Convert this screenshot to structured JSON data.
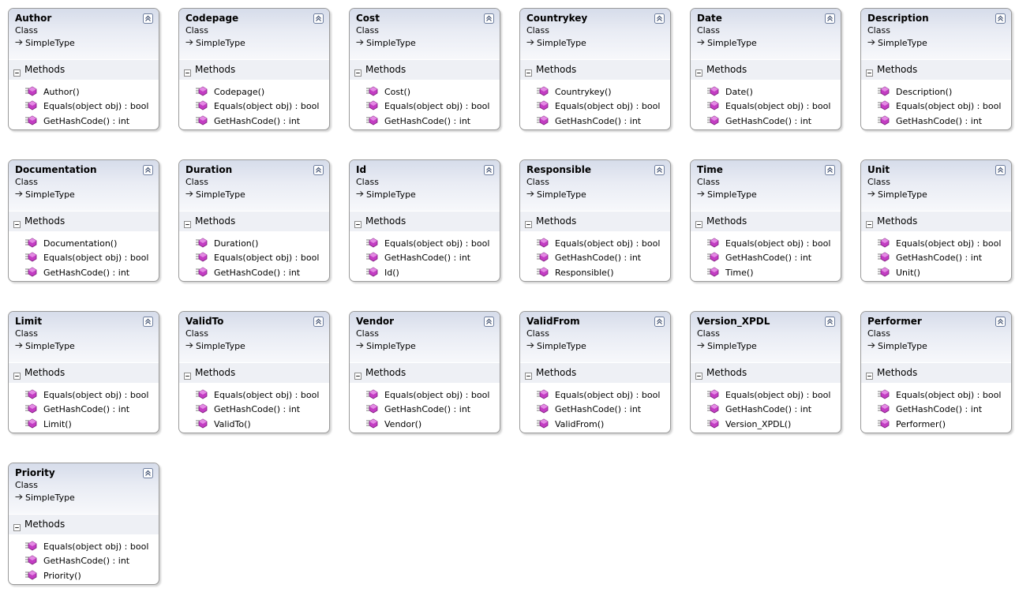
{
  "section_label": "Methods",
  "colors": {
    "border": "#9a9a9a",
    "header_top": "#d6dcea",
    "header_bottom": "#f7f8fb",
    "method_icon": "#c33dc3"
  },
  "icons": {
    "collapse": "double-chevron-up-icon",
    "inheritance": "inheritance-arrow-icon",
    "section_toggle": "minus-square-icon",
    "method": "public-method-icon"
  },
  "classes": [
    {
      "name": "Author",
      "kind": "Class",
      "base": "SimpleType",
      "methods": [
        "Author()",
        "Equals(object obj) : bool",
        "GetHashCode() : int"
      ]
    },
    {
      "name": "Codepage",
      "kind": "Class",
      "base": "SimpleType",
      "methods": [
        "Codepage()",
        "Equals(object obj) : bool",
        "GetHashCode() : int"
      ]
    },
    {
      "name": "Cost",
      "kind": "Class",
      "base": "SimpleType",
      "methods": [
        "Cost()",
        "Equals(object obj) : bool",
        "GetHashCode() : int"
      ]
    },
    {
      "name": "Countrykey",
      "kind": "Class",
      "base": "SimpleType",
      "methods": [
        "Countrykey()",
        "Equals(object obj) : bool",
        "GetHashCode() : int"
      ]
    },
    {
      "name": "Date",
      "kind": "Class",
      "base": "SimpleType",
      "methods": [
        "Date()",
        "Equals(object obj) : bool",
        "GetHashCode() : int"
      ]
    },
    {
      "name": "Description",
      "kind": "Class",
      "base": "SimpleType",
      "methods": [
        "Description()",
        "Equals(object obj) : bool",
        "GetHashCode() : int"
      ]
    },
    {
      "name": "Documentation",
      "kind": "Class",
      "base": "SimpleType",
      "methods": [
        "Documentation()",
        "Equals(object obj) : bool",
        "GetHashCode() : int"
      ]
    },
    {
      "name": "Duration",
      "kind": "Class",
      "base": "SimpleType",
      "methods": [
        "Duration()",
        "Equals(object obj) : bool",
        "GetHashCode() : int"
      ]
    },
    {
      "name": "Id",
      "kind": "Class",
      "base": "SimpleType",
      "methods": [
        "Equals(object obj) : bool",
        "GetHashCode() : int",
        "Id()"
      ]
    },
    {
      "name": "Responsible",
      "kind": "Class",
      "base": "SimpleType",
      "methods": [
        "Equals(object obj) : bool",
        "GetHashCode() : int",
        "Responsible()"
      ]
    },
    {
      "name": "Time",
      "kind": "Class",
      "base": "SimpleType",
      "methods": [
        "Equals(object obj) : bool",
        "GetHashCode() : int",
        "Time()"
      ]
    },
    {
      "name": "Unit",
      "kind": "Class",
      "base": "SimpleType",
      "methods": [
        "Equals(object obj) : bool",
        "GetHashCode() : int",
        "Unit()"
      ]
    },
    {
      "name": "Limit",
      "kind": "Class",
      "base": "SimpleType",
      "methods": [
        "Equals(object obj) : bool",
        "GetHashCode() : int",
        "Limit()"
      ]
    },
    {
      "name": "ValidTo",
      "kind": "Class",
      "base": "SimpleType",
      "methods": [
        "Equals(object obj) : bool",
        "GetHashCode() : int",
        "ValidTo()"
      ]
    },
    {
      "name": "Vendor",
      "kind": "Class",
      "base": "SimpleType",
      "methods": [
        "Equals(object obj) : bool",
        "GetHashCode() : int",
        "Vendor()"
      ]
    },
    {
      "name": "ValidFrom",
      "kind": "Class",
      "base": "SimpleType",
      "methods": [
        "Equals(object obj) : bool",
        "GetHashCode() : int",
        "ValidFrom()"
      ]
    },
    {
      "name": "Version_XPDL",
      "kind": "Class",
      "base": "SimpleType",
      "methods": [
        "Equals(object obj) : bool",
        "GetHashCode() : int",
        "Version_XPDL()"
      ]
    },
    {
      "name": "Performer",
      "kind": "Class",
      "base": "SimpleType",
      "methods": [
        "Equals(object obj) : bool",
        "GetHashCode() : int",
        "Performer()"
      ]
    },
    {
      "name": "Priority",
      "kind": "Class",
      "base": "SimpleType",
      "methods": [
        "Equals(object obj) : bool",
        "GetHashCode() : int",
        "Priority()"
      ]
    }
  ]
}
